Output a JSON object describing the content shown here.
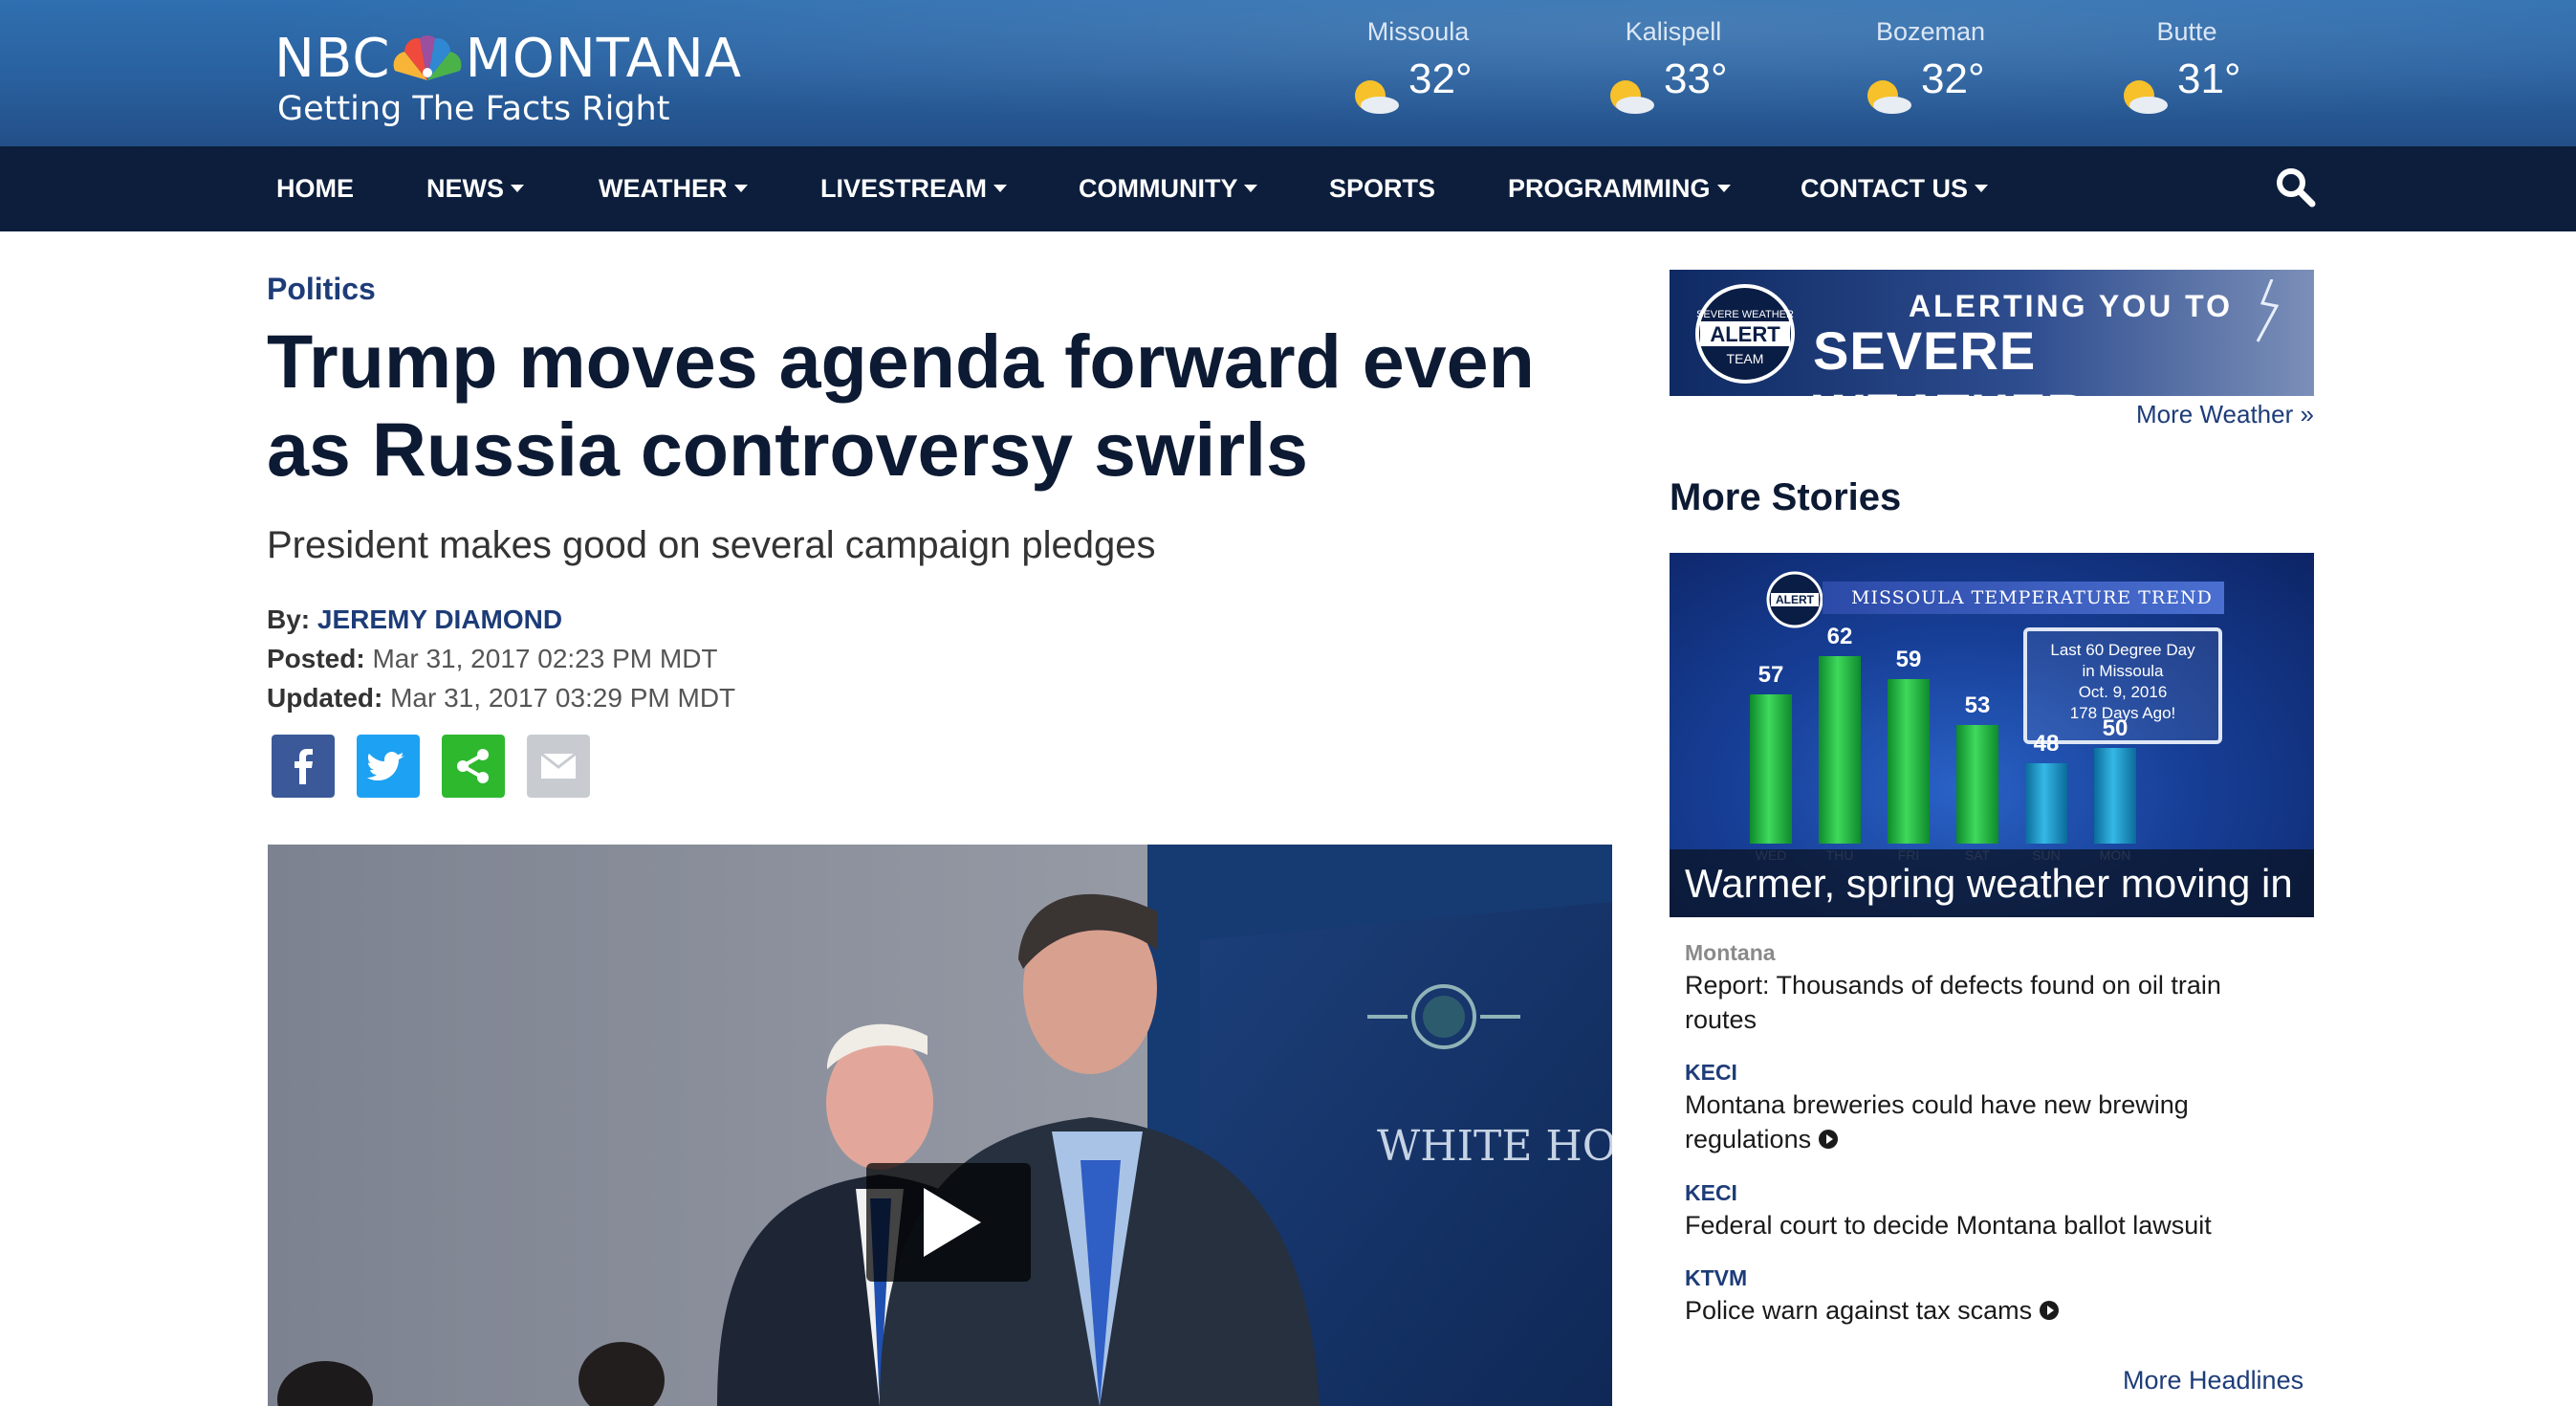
{
  "header": {
    "logo": {
      "network": "NBC",
      "state": "MONTANA",
      "tagline": "Getting The Facts Right"
    },
    "weather": [
      {
        "city": "Missoula",
        "temp": "32°",
        "icon": "partly-cloudy-icon"
      },
      {
        "city": "Kalispell",
        "temp": "33°",
        "icon": "partly-cloudy-icon"
      },
      {
        "city": "Bozeman",
        "temp": "32°",
        "icon": "partly-cloudy-icon"
      },
      {
        "city": "Butte",
        "temp": "31°",
        "icon": "partly-cloudy-icon"
      }
    ]
  },
  "nav": {
    "items": [
      {
        "label": "HOME",
        "dropdown": false
      },
      {
        "label": "NEWS",
        "dropdown": true
      },
      {
        "label": "WEATHER",
        "dropdown": true
      },
      {
        "label": "LIVESTREAM",
        "dropdown": true
      },
      {
        "label": "COMMUNITY",
        "dropdown": true
      },
      {
        "label": "SPORTS",
        "dropdown": false
      },
      {
        "label": "PROGRAMMING",
        "dropdown": true
      },
      {
        "label": "CONTACT US",
        "dropdown": true
      }
    ],
    "search_icon": "search-icon"
  },
  "article": {
    "section": "Politics",
    "headline_line1": "Trump moves agenda forward even",
    "headline_line2": "as Russia controversy swirls",
    "subhead": "President makes good on several campaign pledges",
    "by_label": "By:",
    "author": "JEREMY DIAMOND",
    "posted_label": "Posted:",
    "posted": "Mar 31, 2017 02:23 PM MDT",
    "updated_label": "Updated:",
    "updated": "Mar 31, 2017 03:29 PM MDT",
    "share": [
      {
        "name": "facebook",
        "color": "#3b5998",
        "icon": "facebook-icon"
      },
      {
        "name": "twitter",
        "color": "#1da1f2",
        "icon": "twitter-icon"
      },
      {
        "name": "share",
        "color": "#2eb82e",
        "icon": "share-icon"
      },
      {
        "name": "email",
        "color": "#c8ccd0",
        "icon": "email-icon"
      }
    ],
    "video": {
      "backdrop_text": "WHITE HOUSE",
      "icon": "play-icon"
    }
  },
  "sidebar": {
    "alert": {
      "badge_top": "SEVERE WEATHER",
      "badge_mid": "ALERT",
      "badge_bottom": "TEAM",
      "line1": "ALERTING YOU TO",
      "line2": "SEVERE WEATHER"
    },
    "more_weather": "More Weather »",
    "more_stories_title": "More Stories",
    "feature": {
      "banner": "MISSOULA TEMPERATURE TREND",
      "badge": "ALERT",
      "note": [
        "Last 60 Degree Day",
        "in Missoula",
        "Oct. 9, 2016",
        "178 Days Ago!"
      ],
      "bars": [
        {
          "day": "WED",
          "value": 57
        },
        {
          "day": "THU",
          "value": 62
        },
        {
          "day": "FRI",
          "value": 59
        },
        {
          "day": "SAT",
          "value": 53
        },
        {
          "day": "SUN",
          "value": 48
        },
        {
          "day": "MON",
          "value": 50
        }
      ],
      "caption": "Warmer, spring weather moving in"
    },
    "stories": [
      {
        "tag": "Montana",
        "title": "Report: Thousands of defects found on oil train routes",
        "video": false
      },
      {
        "tag": "KECI",
        "title": "Montana breweries could have new brewing regulations",
        "video": true
      },
      {
        "tag": "KECI",
        "title": "Federal court to decide Montana ballot lawsuit",
        "video": false
      },
      {
        "tag": "KTVM",
        "title": "Police warn against tax scams",
        "video": true
      }
    ],
    "more_headlines": "More Headlines"
  },
  "colors": {
    "nav_bg": "#0c1e3c",
    "link": "#1d3c78",
    "headline": "#0d1a33"
  }
}
